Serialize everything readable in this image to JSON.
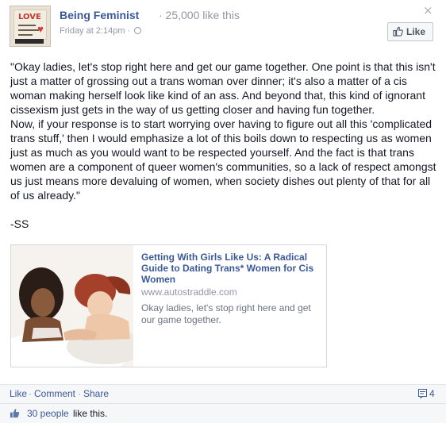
{
  "header": {
    "page_name": "Being Feminist",
    "likes_text": "· 25,000 like this",
    "timestamp": "Friday at 2:14pm ·",
    "close_glyph": "×",
    "like_button": "Like",
    "avatar_sign_text": "LOVE"
  },
  "post": {
    "paragraph1": "\"Okay ladies, let's stop right here and get our game together. One point is that this isn't just a matter of grossing out a trans woman over dinner; it's also a matter of a cis woman making herself look like kind of an ass. And beyond that, this kind of ignorant cissexism just gets in the way of us getting closer and having fun together.",
    "paragraph2": "Now, if your response is to start worrying over having to figure out all this 'complicated trans stuff,' then I would emphasize a lot of this boils down to respecting us as women just as much as you would want to be respected yourself. And the fact is that trans women are a component of queer women's communities, so a lack of respect amongst us just means more devaluing of women, when society dishes out plenty of that for all of us already.\"",
    "signature": "-SS"
  },
  "link": {
    "title": "Getting With Girls Like Us: A Radical Guide to Dating Trans* Women for Cis Women",
    "domain": "www.autostraddle.com",
    "description": "Okay ladies, let's stop right here and get our game together."
  },
  "actions": {
    "like": "Like",
    "comment": "Comment",
    "share": "Share",
    "separator": "·",
    "comment_count": "4"
  },
  "likes_bar": {
    "people": "30 people",
    "suffix": "like this."
  },
  "colors": {
    "link_blue": "#3b5998",
    "meta_gray": "#9197a3",
    "text": "#141823",
    "footer_bg": "#f6f7f9"
  },
  "icons": [
    "close-icon",
    "thumbs-up-icon",
    "globe-icon",
    "comment-icon"
  ]
}
